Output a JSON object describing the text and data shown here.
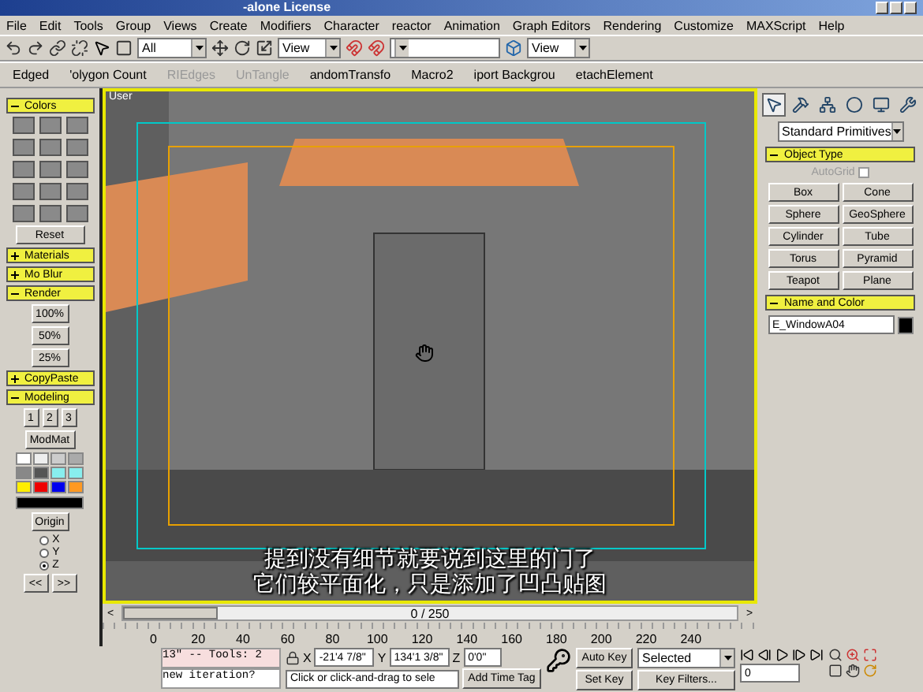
{
  "window": {
    "title": "-alone License"
  },
  "menu": [
    "File",
    "Edit",
    "Tools",
    "Group",
    "Views",
    "Create",
    "Modifiers",
    "Character",
    "reactor",
    "Animation",
    "Graph Editors",
    "Rendering",
    "Customize",
    "MAXScript",
    "Help"
  ],
  "main_toolbar": {
    "selection_filter": "All",
    "reference_coord": "View",
    "render_type": "View"
  },
  "macro_toolbar": [
    {
      "label": "Edged",
      "disabled": false
    },
    {
      "label": "'olygon Count",
      "disabled": false
    },
    {
      "label": "RIEdges",
      "disabled": true
    },
    {
      "label": "UnTangle",
      "disabled": true
    },
    {
      "label": "andomTransfo",
      "disabled": false
    },
    {
      "label": "Macro2",
      "disabled": false
    },
    {
      "label": "iport Backgrou",
      "disabled": false
    },
    {
      "label": "etachElement",
      "disabled": false
    }
  ],
  "left_panel": {
    "rollouts": [
      {
        "title": "Colors",
        "expanded": true,
        "kind": "swatches",
        "button": "Reset"
      },
      {
        "title": "Materials",
        "expanded": false
      },
      {
        "title": "Mo Blur",
        "expanded": false
      },
      {
        "title": "Render",
        "expanded": true,
        "kind": "buttons",
        "buttons": [
          "100%",
          "50%",
          "25%"
        ]
      },
      {
        "title": "CopyPaste",
        "expanded": false
      },
      {
        "title": "Modeling",
        "expanded": true,
        "kind": "modeling",
        "numbers": [
          "1",
          "2",
          "3"
        ],
        "button": "ModMat",
        "swatches": [
          {
            "color": "#ffffff"
          },
          {
            "color": "#eeeeee"
          },
          {
            "color": "#cccccc"
          },
          {
            "color": "#aaaaaa"
          },
          {
            "color": "#888888"
          },
          {
            "color": "#555555"
          },
          {
            "color": "#88eeee"
          },
          {
            "color": "#88eeee"
          },
          {
            "color": "#ffee00"
          },
          {
            "color": "#ee0000"
          },
          {
            "color": "#0000ee"
          },
          {
            "color": "#ff9922"
          }
        ],
        "origin": "Origin",
        "axes": [
          {
            "label": "X",
            "selected": false
          },
          {
            "label": "Y",
            "selected": false
          },
          {
            "label": "Z",
            "selected": true
          }
        ],
        "arrows": [
          "<<",
          ">>"
        ]
      }
    ]
  },
  "viewport": {
    "label": "User",
    "subtitles": [
      "提到没有细节就要说到这里的门了",
      "它们较平面化，只是添加了凹凸贴图"
    ]
  },
  "time_slider": {
    "reading": "0 / 250",
    "prev": "<",
    "next": ">",
    "level": 0
  },
  "track_bar": {
    "ticks": [
      "0",
      "20",
      "40",
      "60",
      "80",
      "100",
      "120",
      "140",
      "160",
      "180",
      "200",
      "220",
      "240"
    ]
  },
  "command_panel": {
    "tabs": [
      {
        "selected": true
      },
      {
        "selected": false
      },
      {
        "selected": false
      },
      {
        "selected": false
      },
      {
        "selected": false
      },
      {
        "selected": false
      }
    ],
    "category": "Standard Primitives",
    "object_type": {
      "title": "Object Type",
      "autogrid": {
        "label": "AutoGrid",
        "checked": false
      },
      "buttons": [
        "Box",
        "Cone",
        "Sphere",
        "GeoSphere",
        "Cylinder",
        "Tube",
        "Torus",
        "Pyramid",
        "Teapot",
        "Plane"
      ]
    },
    "name_and_color": {
      "title": "Name and Color",
      "name": "E_WindowA04",
      "color": "#000000"
    }
  },
  "status_bar": {
    "listener": [
      "13\"  -- Tools: 2",
      "new iteration?"
    ],
    "coords": [
      {
        "axis": "X",
        "value": "-21'4 7/8\""
      },
      {
        "axis": "Y",
        "value": "134'1 3/8\""
      },
      {
        "axis": "Z",
        "value": "0'0\""
      }
    ],
    "prompt": "Click or click-and-drag to sele",
    "time_tag": "Add Time Tag",
    "auto_key": "Auto Key",
    "key_mode": "Selected",
    "set_key": "Set Key",
    "key_filters": "Key Filters...",
    "frame": "0"
  }
}
